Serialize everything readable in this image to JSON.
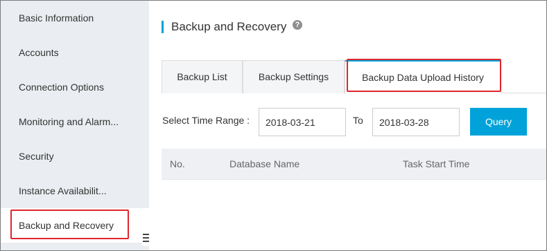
{
  "sidebar": {
    "items": [
      {
        "label": "Basic Information"
      },
      {
        "label": "Accounts"
      },
      {
        "label": "Connection Options"
      },
      {
        "label": "Monitoring and Alarm..."
      },
      {
        "label": "Security"
      },
      {
        "label": "Instance Availabilit..."
      },
      {
        "label": "Backup and Recovery",
        "active": true
      }
    ]
  },
  "main": {
    "title": "Backup and Recovery",
    "help_icon": "question-circle-icon",
    "help_glyph": "?",
    "tabs": [
      {
        "label": "Backup List"
      },
      {
        "label": "Backup Settings"
      },
      {
        "label": "Backup Data Upload History",
        "selected": true
      }
    ],
    "filter": {
      "time_range_label": "Select Time Range :",
      "start_date": "2018-03-21",
      "to_label": "To",
      "end_date": "2018-03-28",
      "query_label": "Query"
    },
    "table": {
      "columns": [
        "No.",
        "Database Name",
        "Task Start Time"
      ]
    }
  },
  "colors": {
    "accent": "#00a2d9",
    "highlight_box": "#e0252e",
    "sidebar_bg": "#eaedf1",
    "table_header_bg": "#eef0f4"
  }
}
